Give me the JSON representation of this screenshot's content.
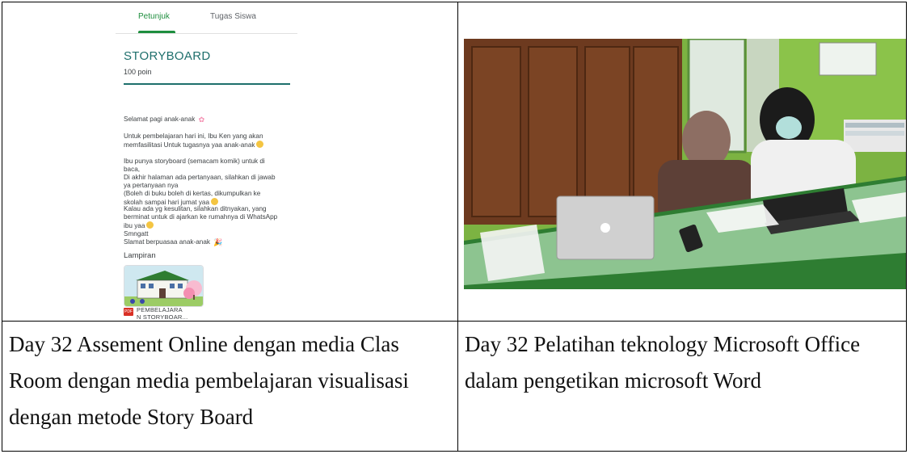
{
  "classroom": {
    "tabs": [
      {
        "label": "Petunjuk",
        "active": true
      },
      {
        "label": "Tugas Siswa",
        "active": false
      }
    ],
    "assignment": {
      "title": "STORYBOARD",
      "points": "100 poin",
      "greeting": "Selamat pagi anak-anak",
      "para1": "Untuk pembelajaran hari ini, Ibu Ken yang akan\nmemfasilitasi Untuk tugasnya yaa anak-anak",
      "para2": "Ibu punya storyboard (semacam komik) untuk di\nbaca,\nDi akhir halaman ada pertanyaan, silahkan di jawab\nya pertanyaan nya\n(Boleh di buku boleh di kertas, dikumpulkan ke\nskolah sampai hari jumat yaa",
      "para3": "Kalau ada yg kesulitan, silahkan ditnyakan, yang\nberminat untuk di ajarkan ke rumahnya di WhatsApp\nibu yaa",
      "para4": "Smngatt\nSlamat berpuasaa anak-anak"
    },
    "attachments_label": "Lampiran",
    "attachment": {
      "badge": "PDF",
      "name": "PEMBELAJARA\nN STORYBOAR..."
    }
  },
  "captions": {
    "left": "Day 32 Assement Online dengan media Clas Room dengan media pembelajaran visualisasi dengan metode Story Board",
    "right": "Day 32 Pelatihan teknology Microsoft Office dalam pengetikan microsoft Word"
  },
  "colors": {
    "accent_green": "#1e8e3e",
    "title_teal": "#1e6f6c",
    "wall_green": "#7cb342",
    "cabinet_brown": "#6d3a1f"
  }
}
